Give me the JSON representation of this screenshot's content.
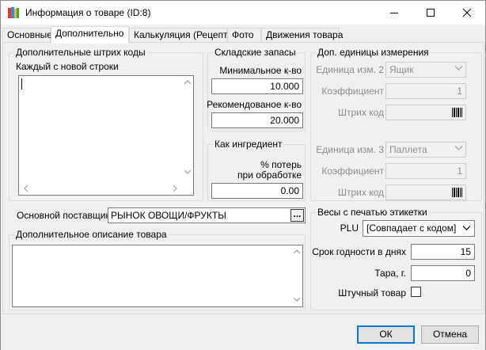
{
  "window": {
    "title": "Информация о товаре (ID:8)"
  },
  "tabs": [
    {
      "label": "Основные"
    },
    {
      "label": "Дополнительно"
    },
    {
      "label": "Калькуляция (Рецепт)"
    },
    {
      "label": "Фото"
    },
    {
      "label": "Движения товара"
    }
  ],
  "barcodes": {
    "group_label": "Дополнительные штрих коды",
    "hint": "Каждый с новой строки",
    "value": ""
  },
  "stock": {
    "group_label": "Складские запасы",
    "min_label": "Минимальное к-во",
    "min_value": "10.000",
    "rec_label": "Рекомендованое к-во",
    "rec_value": "20.000"
  },
  "ingredient": {
    "group_label": "Как ингредиент",
    "loss_label_1": "% потерь",
    "loss_label_2": "при обработке",
    "loss_value": "0.00"
  },
  "units": {
    "group_label": "Доп. единицы измерения",
    "unit2_label": "Единица изм. 2",
    "unit2_value": "Ящик",
    "coef2_label": "Коэффициент",
    "coef2_value": "1",
    "barcode2_label": "Штрих код",
    "unit3_label": "Единица изм. 3",
    "unit3_value": "Паллета",
    "coef3_label": "Коэффициент",
    "coef3_value": "1",
    "barcode3_label": "Штрих код"
  },
  "supplier": {
    "label": "Основной поставщик",
    "value": "РЫНОК ОВОЩИ/ФРУКТЫ",
    "browse_label": "..."
  },
  "description": {
    "group_label": "Дополнительное описание товара",
    "value": ""
  },
  "scales": {
    "group_label": "Весы с печатью этикетки",
    "plu_label": "PLU",
    "plu_value": "[Совпадает с кодом]",
    "shelf_label": "Срок годности в днях",
    "shelf_value": "15",
    "tare_label": "Тара, г.",
    "tare_value": "0",
    "piece_label": "Штучный товар"
  },
  "buttons": {
    "ok": "ОК",
    "cancel": "Отмена"
  },
  "colors": {
    "accent": "#0078d7",
    "scrollbar": "#a0a0a0"
  }
}
